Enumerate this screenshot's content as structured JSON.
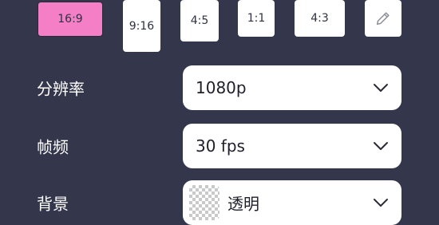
{
  "aspect_ratios": {
    "options": [
      "16:9",
      "9:16",
      "4:5",
      "1:1",
      "4:3"
    ],
    "selected": "16:9",
    "selected_color": "#f57fc7",
    "edit_icon": "pencil-icon"
  },
  "settings": {
    "resolution": {
      "label": "分辨率",
      "value": "1080p"
    },
    "frame_rate": {
      "label": "帧频",
      "value": "30 fps"
    },
    "background": {
      "label": "背景",
      "value": "透明",
      "swatch": "transparent-checker-icon"
    }
  },
  "colors": {
    "page_background": "#34364c",
    "card": "#ffffff"
  }
}
